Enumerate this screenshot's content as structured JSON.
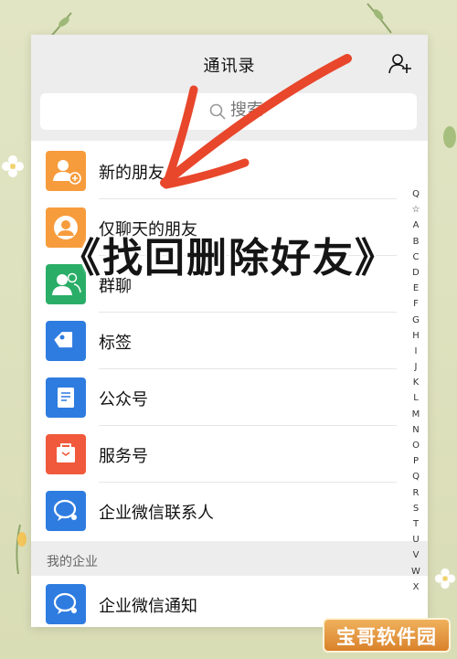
{
  "header": {
    "title": "通讯录"
  },
  "search": {
    "placeholder": "搜索"
  },
  "rows": [
    {
      "label": "新的朋友",
      "icon": "add-friend-icon",
      "color": "#f79c3c"
    },
    {
      "label": "仅聊天的朋友",
      "icon": "chat-only-friends-icon",
      "color": "#f79c3c"
    },
    {
      "label": "群聊",
      "icon": "group-chat-icon",
      "color": "#2aae67"
    },
    {
      "label": "标签",
      "icon": "tag-icon",
      "color": "#2e7ce0"
    },
    {
      "label": "公众号",
      "icon": "official-account-icon",
      "color": "#2e7ce0"
    },
    {
      "label": "服务号",
      "icon": "service-account-icon",
      "color": "#f0593b"
    },
    {
      "label": "企业微信联系人",
      "icon": "wecom-contacts-icon",
      "color": "#2e7ce0"
    }
  ],
  "section": {
    "label": "我的企业"
  },
  "enterprise_row": {
    "label": "企业微信通知",
    "icon": "wecom-notify-icon",
    "color": "#2e7ce0"
  },
  "index_letters": [
    "Q",
    "☆",
    "A",
    "B",
    "C",
    "D",
    "E",
    "F",
    "G",
    "H",
    "I",
    "J",
    "K",
    "L",
    "M",
    "N",
    "O",
    "P",
    "Q",
    "R",
    "S",
    "T",
    "U",
    "V",
    "W",
    "X"
  ],
  "overlay_title": "《找回删除好友》",
  "watermark": "宝哥软件园",
  "arrow_color": "#e8472c"
}
